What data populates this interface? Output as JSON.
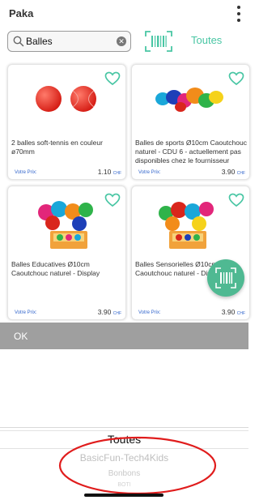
{
  "header": {
    "title": "Paka"
  },
  "search": {
    "value": "Balles"
  },
  "filter": {
    "label": "Toutes"
  },
  "products": [
    {
      "title": "2 balles soft-tennis en couleur ø70mm",
      "price_label": "Votre Prix:",
      "price": "1.10",
      "currency": "CHF"
    },
    {
      "title": "Balles de sports Ø10cm Caoutchouc naturel - CDU 6 - actuellement pas disponibles chez le fournisseur",
      "price_label": "Votre Prix:",
      "price": "3.90",
      "currency": "CHF"
    },
    {
      "title": "Balles Educatives Ø10cm Caoutchouc naturel - Display",
      "price_label": "Votre Prix:",
      "price": "3.90",
      "currency": "CHF"
    },
    {
      "title": "Balles Sensorielles Ø10cm Caoutchouc naturel - Display de 6",
      "price_label": "Votre Prix:",
      "price": "3.90",
      "currency": "CHF"
    }
  ],
  "ok_button": {
    "label": "OK"
  },
  "picker": {
    "options": [
      "Toutes",
      "BasicFun-Tech4Kids",
      "Bonbons",
      "BOTI"
    ],
    "selected": "Toutes"
  },
  "colors": {
    "accent": "#49c6a4",
    "fab": "#4fb992",
    "ok_bar": "#9f9f9f",
    "annotation": "#e01c1c"
  }
}
